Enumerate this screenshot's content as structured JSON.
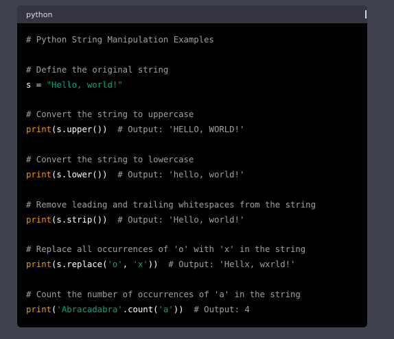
{
  "header": {
    "language": "python"
  },
  "colors": {
    "background": "#40414f",
    "code_bg": "#000000",
    "header_bg": "#343541",
    "comment": "#a0a0a0",
    "function": "#e9950c",
    "string": "#00a67d",
    "text": "#ffffff"
  },
  "code_lines": [
    [
      {
        "t": "comment",
        "v": "# Python String Manipulation Examples"
      }
    ],
    [],
    [
      {
        "t": "comment",
        "v": "# Define the original string"
      }
    ],
    [
      {
        "t": "plain",
        "v": "s = "
      },
      {
        "t": "str",
        "v": "\"Hello, world!\""
      }
    ],
    [],
    [
      {
        "t": "comment",
        "v": "# Convert the string to uppercase"
      }
    ],
    [
      {
        "t": "func",
        "v": "print"
      },
      {
        "t": "plain",
        "v": "(s.upper())  "
      },
      {
        "t": "comment",
        "v": "# Output: 'HELLO, WORLD!'"
      }
    ],
    [],
    [
      {
        "t": "comment",
        "v": "# Convert the string to lowercase"
      }
    ],
    [
      {
        "t": "func",
        "v": "print"
      },
      {
        "t": "plain",
        "v": "(s.lower())  "
      },
      {
        "t": "comment",
        "v": "# Output: 'hello, world!'"
      }
    ],
    [],
    [
      {
        "t": "comment",
        "v": "# Remove leading and trailing whitespaces from the string"
      }
    ],
    [
      {
        "t": "func",
        "v": "print"
      },
      {
        "t": "plain",
        "v": "(s.strip())  "
      },
      {
        "t": "comment",
        "v": "# Output: 'Hello, world!'"
      }
    ],
    [],
    [
      {
        "t": "comment",
        "v": "# Replace all occurrences of 'o' with 'x' in the string"
      }
    ],
    [
      {
        "t": "func",
        "v": "print"
      },
      {
        "t": "plain",
        "v": "(s.replace("
      },
      {
        "t": "str",
        "v": "'o'"
      },
      {
        "t": "plain",
        "v": ", "
      },
      {
        "t": "str",
        "v": "'x'"
      },
      {
        "t": "plain",
        "v": "))  "
      },
      {
        "t": "comment",
        "v": "# Output: 'Hellx, wxrld!'"
      }
    ],
    [],
    [
      {
        "t": "comment",
        "v": "# Count the number of occurrences of 'a' in the string"
      }
    ],
    [
      {
        "t": "func",
        "v": "print"
      },
      {
        "t": "plain",
        "v": "("
      },
      {
        "t": "str",
        "v": "'Abracadabra'"
      },
      {
        "t": "plain",
        "v": ".count("
      },
      {
        "t": "str",
        "v": "'a'"
      },
      {
        "t": "plain",
        "v": "))  "
      },
      {
        "t": "comment",
        "v": "# Output: 4"
      }
    ]
  ]
}
